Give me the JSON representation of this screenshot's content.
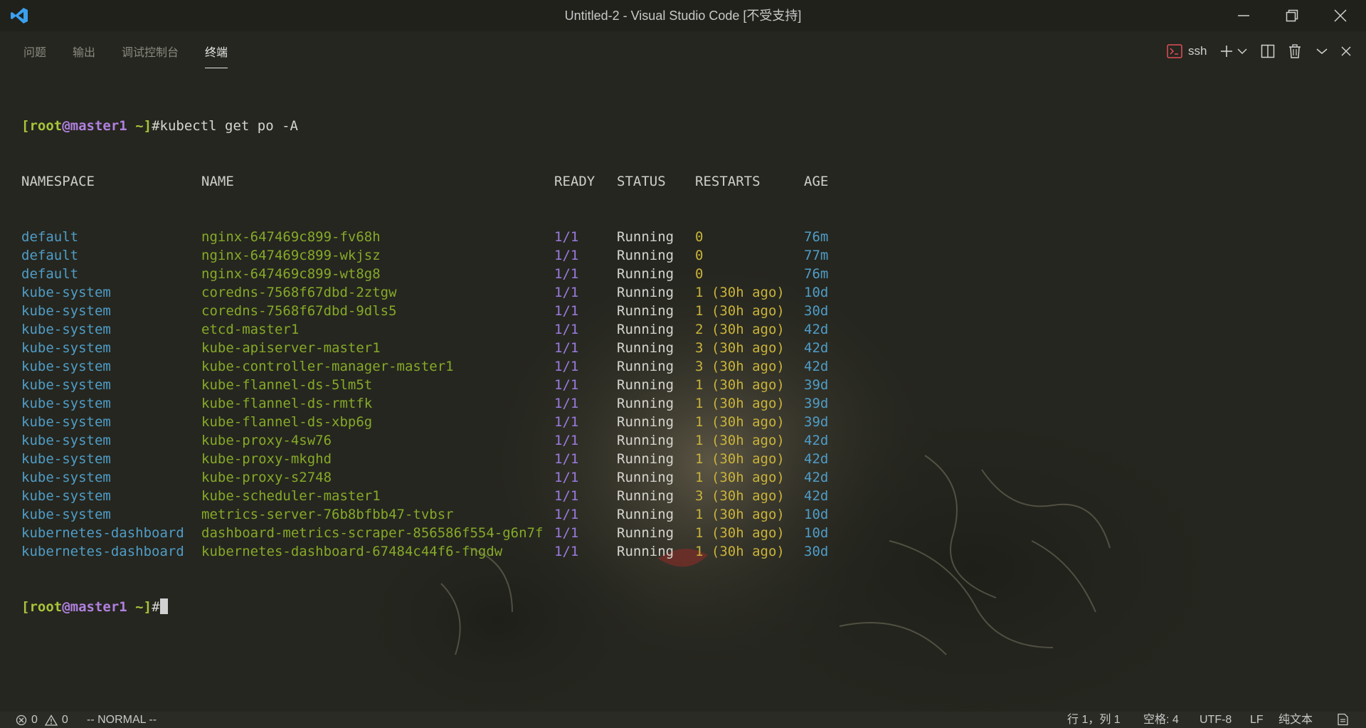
{
  "window": {
    "title": "Untitled-2 - Visual Studio Code [不受支持]",
    "logo_icon": "vscode-logo-icon",
    "minimize_icon": "minimize-icon",
    "restore_icon": "restore-icon",
    "close_icon": "close-icon"
  },
  "panel": {
    "tabs": [
      {
        "label": "问题",
        "active": false
      },
      {
        "label": "输出",
        "active": false
      },
      {
        "label": "调试控制台",
        "active": false
      },
      {
        "label": "终端",
        "active": true
      }
    ],
    "terminal_name": "ssh",
    "actions": [
      "terminal-icon",
      "plus-icon",
      "chevron-down-icon",
      "split-icon",
      "trash-icon",
      "chevron-down-icon",
      "close-icon"
    ]
  },
  "terminal": {
    "prompt_user": "[root@master1 ~]",
    "command": "#kubectl get po -A",
    "prompt_end": "#",
    "headers": {
      "namespace": "NAMESPACE",
      "name": "NAME",
      "ready": "READY",
      "status": "STATUS",
      "restarts": "RESTARTS",
      "age": "AGE"
    },
    "rows": [
      {
        "namespace": "default",
        "name": "nginx-647469c899-fv68h",
        "ready": "1/1",
        "status": "Running",
        "restarts": "0",
        "age": "76m"
      },
      {
        "namespace": "default",
        "name": "nginx-647469c899-wkjsz",
        "ready": "1/1",
        "status": "Running",
        "restarts": "0",
        "age": "77m"
      },
      {
        "namespace": "default",
        "name": "nginx-647469c899-wt8g8",
        "ready": "1/1",
        "status": "Running",
        "restarts": "0",
        "age": "76m"
      },
      {
        "namespace": "kube-system",
        "name": "coredns-7568f67dbd-2ztgw",
        "ready": "1/1",
        "status": "Running",
        "restarts": "1 (30h ago)",
        "age": "10d"
      },
      {
        "namespace": "kube-system",
        "name": "coredns-7568f67dbd-9dls5",
        "ready": "1/1",
        "status": "Running",
        "restarts": "1 (30h ago)",
        "age": "30d"
      },
      {
        "namespace": "kube-system",
        "name": "etcd-master1",
        "ready": "1/1",
        "status": "Running",
        "restarts": "2 (30h ago)",
        "age": "42d"
      },
      {
        "namespace": "kube-system",
        "name": "kube-apiserver-master1",
        "ready": "1/1",
        "status": "Running",
        "restarts": "3 (30h ago)",
        "age": "42d"
      },
      {
        "namespace": "kube-system",
        "name": "kube-controller-manager-master1",
        "ready": "1/1",
        "status": "Running",
        "restarts": "3 (30h ago)",
        "age": "42d"
      },
      {
        "namespace": "kube-system",
        "name": "kube-flannel-ds-5lm5t",
        "ready": "1/1",
        "status": "Running",
        "restarts": "1 (30h ago)",
        "age": "39d"
      },
      {
        "namespace": "kube-system",
        "name": "kube-flannel-ds-rmtfk",
        "ready": "1/1",
        "status": "Running",
        "restarts": "1 (30h ago)",
        "age": "39d"
      },
      {
        "namespace": "kube-system",
        "name": "kube-flannel-ds-xbp6g",
        "ready": "1/1",
        "status": "Running",
        "restarts": "1 (30h ago)",
        "age": "39d"
      },
      {
        "namespace": "kube-system",
        "name": "kube-proxy-4sw76",
        "ready": "1/1",
        "status": "Running",
        "restarts": "1 (30h ago)",
        "age": "42d"
      },
      {
        "namespace": "kube-system",
        "name": "kube-proxy-mkghd",
        "ready": "1/1",
        "status": "Running",
        "restarts": "1 (30h ago)",
        "age": "42d"
      },
      {
        "namespace": "kube-system",
        "name": "kube-proxy-s2748",
        "ready": "1/1",
        "status": "Running",
        "restarts": "1 (30h ago)",
        "age": "42d"
      },
      {
        "namespace": "kube-system",
        "name": "kube-scheduler-master1",
        "ready": "1/1",
        "status": "Running",
        "restarts": "3 (30h ago)",
        "age": "42d"
      },
      {
        "namespace": "kube-system",
        "name": "metrics-server-76b8bfbb47-tvbsr",
        "ready": "1/1",
        "status": "Running",
        "restarts": "1 (30h ago)",
        "age": "10d"
      },
      {
        "namespace": "kubernetes-dashboard",
        "name": "dashboard-metrics-scraper-856586f554-g6n7f",
        "ready": "1/1",
        "status": "Running",
        "restarts": "1 (30h ago)",
        "age": "10d"
      },
      {
        "namespace": "kubernetes-dashboard",
        "name": "kubernetes-dashboard-67484c44f6-fngdw",
        "ready": "1/1",
        "status": "Running",
        "restarts": "1 (30h ago)",
        "age": "30d"
      }
    ]
  },
  "statusbar": {
    "errors": "0",
    "warnings": "0",
    "mode": "-- NORMAL --",
    "cursor_pos": "行 1，列 1",
    "indent": "空格: 4",
    "encoding": "UTF-8",
    "eol": "LF",
    "language": "纯文本"
  },
  "colors": {
    "namespace": "#4f9dc8",
    "name": "#86a928",
    "ready": "#9a7be0",
    "restarts": "#c9b33a"
  }
}
